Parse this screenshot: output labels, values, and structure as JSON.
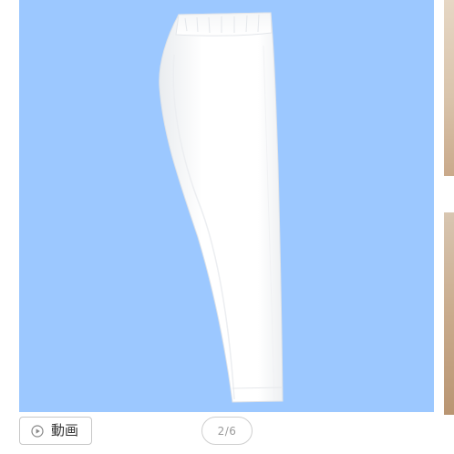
{
  "gallery": {
    "main_image_alt": "white-pants-product-photo",
    "background_color": "#9cc8ff",
    "current_page": 2,
    "total_pages": 6,
    "page_indicator_text": "2/6"
  },
  "video_button": {
    "label": "動画",
    "icon": "play-circle-icon"
  },
  "thumbnails": [
    {
      "icon": "product-thumbnail"
    },
    {
      "icon": "product-thumbnail"
    }
  ]
}
